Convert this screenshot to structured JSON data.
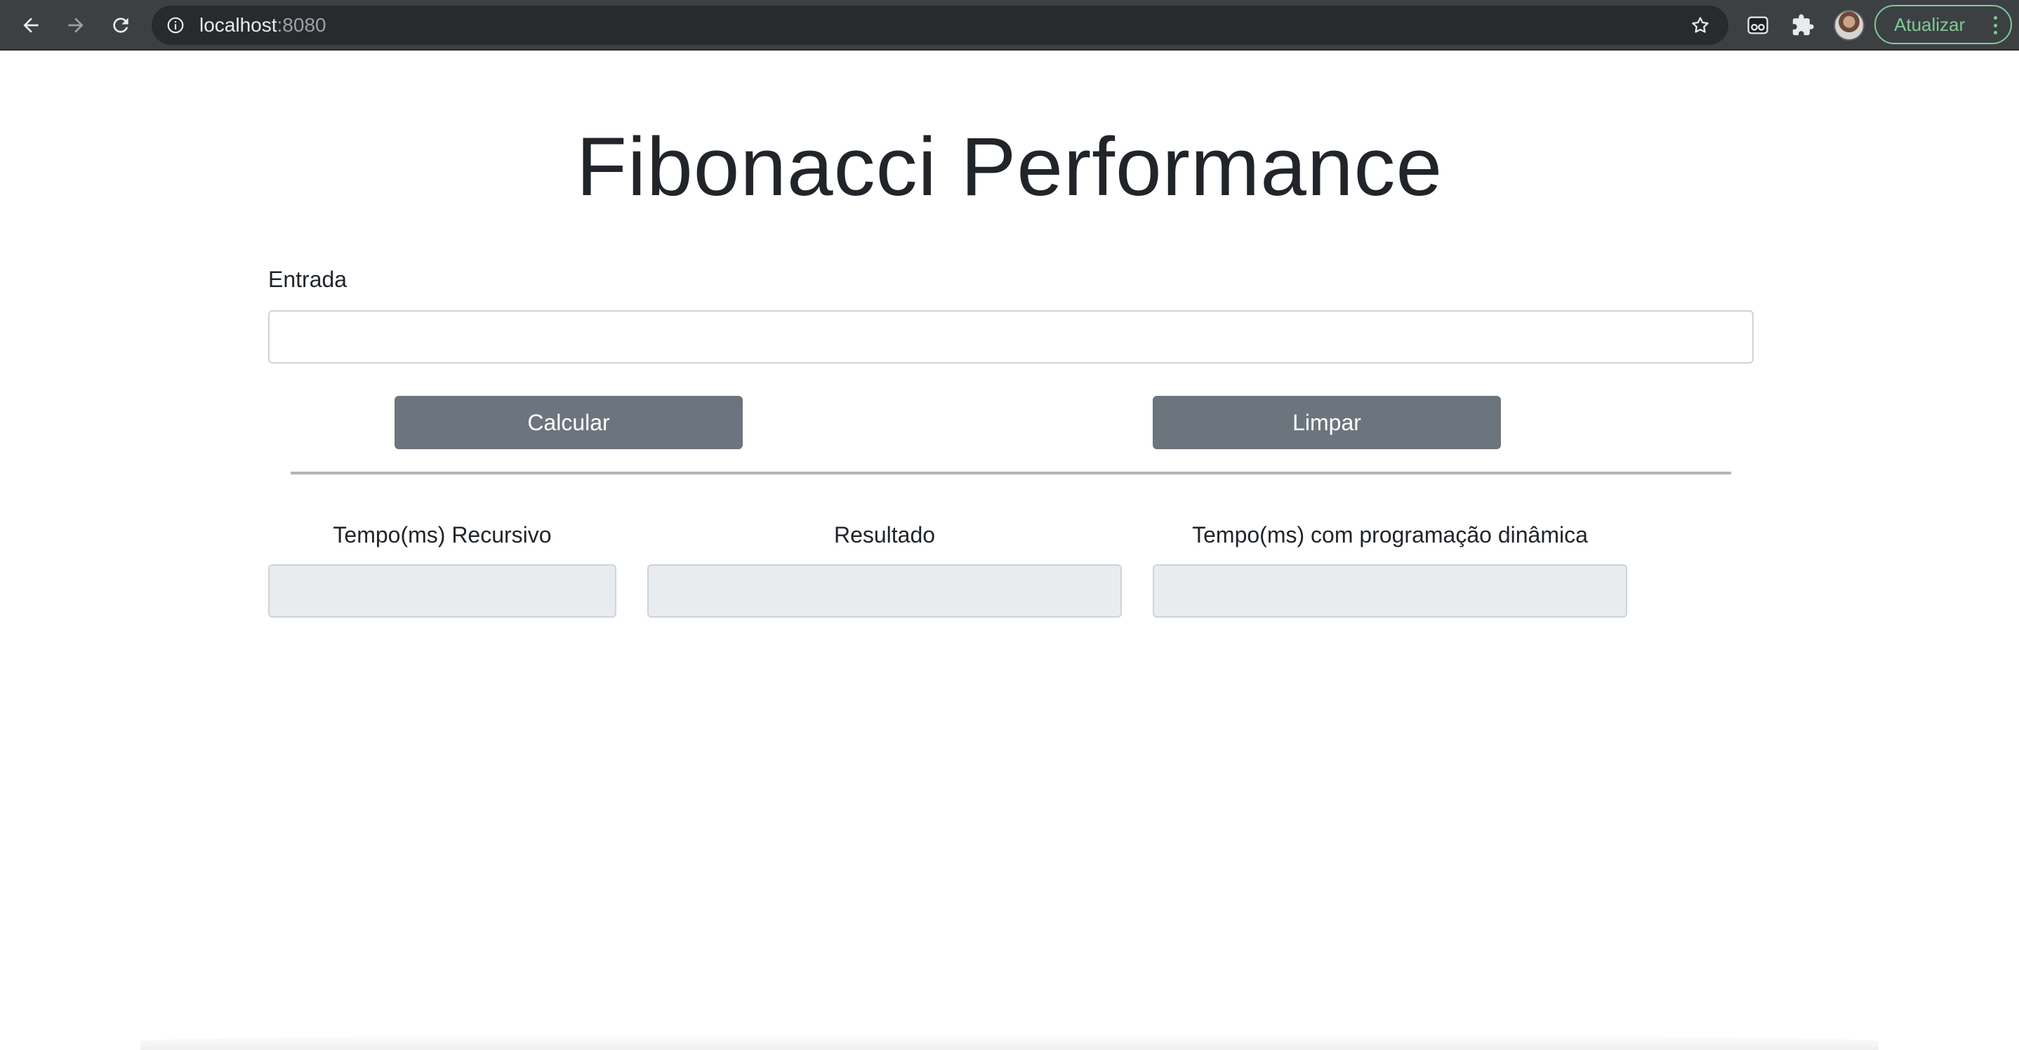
{
  "browser": {
    "url_host": "localhost",
    "url_port": ":8080",
    "update_label": "Atualizar",
    "icons": {
      "back": "arrow-left-icon",
      "forward": "arrow-right-icon",
      "reload": "reload-icon",
      "info": "info-icon",
      "bookmark": "star-icon",
      "extension_reader": "reader-mode-icon",
      "extensions": "puzzle-icon",
      "profile": "avatar"
    },
    "colors": {
      "chrome_bg": "#3c4043",
      "omnibox_bg": "#282a2d",
      "update_accent": "#81c995"
    }
  },
  "page": {
    "title": "Fibonacci Performance",
    "input": {
      "label": "Entrada",
      "value": "",
      "placeholder": ""
    },
    "buttons": {
      "calculate": "Calcular",
      "clear": "Limpar"
    },
    "outputs": {
      "recursive_label": "Tempo(ms) Recursivo",
      "recursive_value": "",
      "result_label": "Resultado",
      "result_value": "",
      "dynamic_label": "Tempo(ms) com programação dinâmica",
      "dynamic_value": ""
    },
    "colors": {
      "button_bg": "#6c757d",
      "readonly_bg": "#e9ecef",
      "text": "#212529"
    }
  }
}
